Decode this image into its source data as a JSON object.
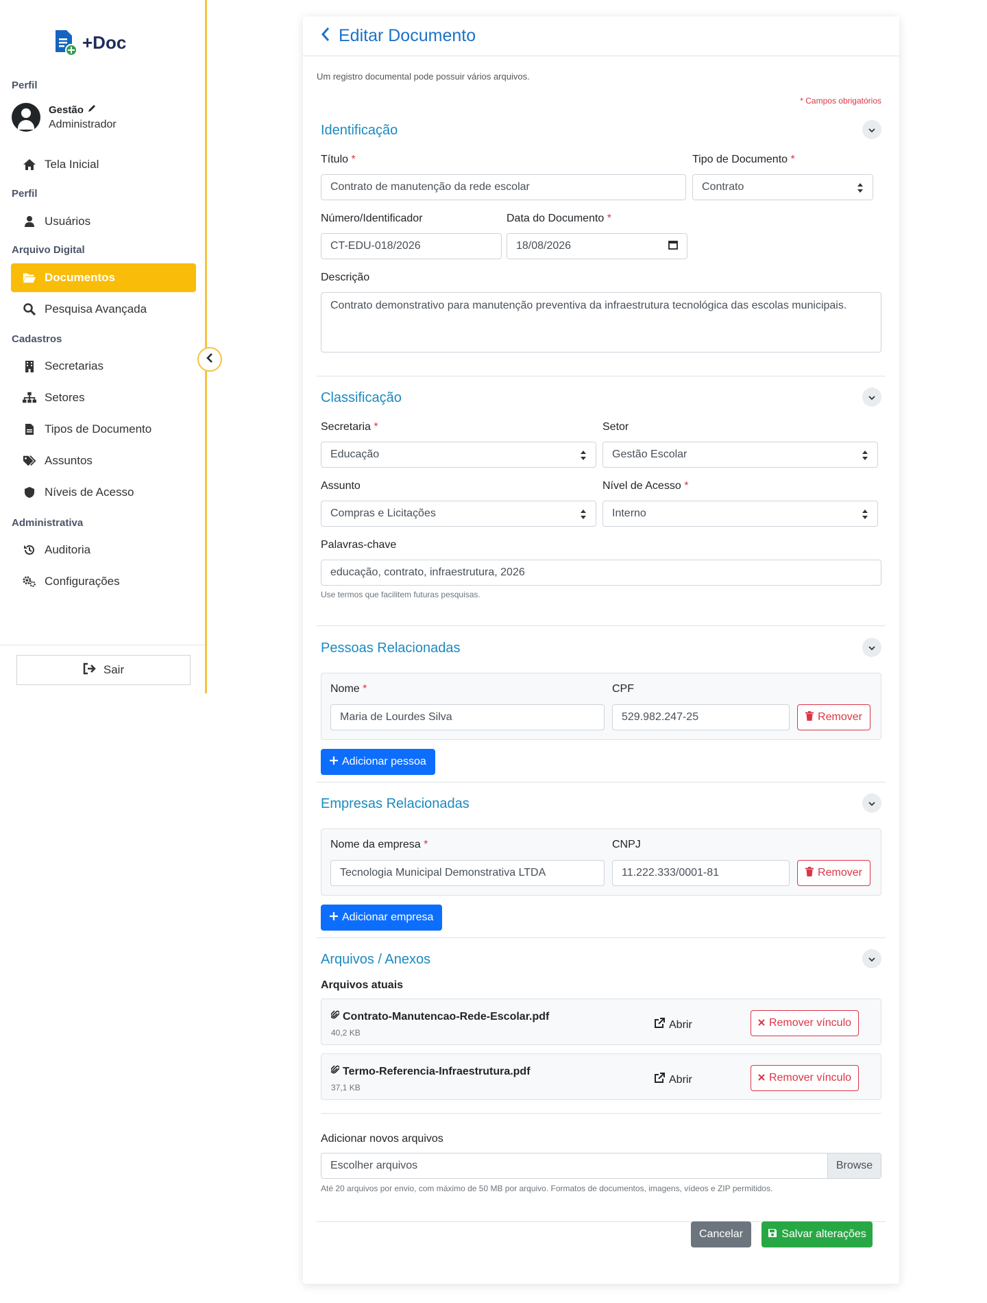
{
  "app": {
    "logo_text": "+Doc"
  },
  "sidebar": {
    "profile_label": "Perfil",
    "profile": {
      "name": "Gestão",
      "role": "Administrador"
    },
    "items": [
      {
        "label": "Tela Inicial",
        "icon": "home-icon"
      },
      {
        "section": "Perfil"
      },
      {
        "label": "Usuários",
        "icon": "user-icon"
      },
      {
        "section": "Arquivo Digital"
      },
      {
        "label": "Documentos",
        "icon": "folder-open-icon",
        "active": true
      },
      {
        "label": "Pesquisa Avançada",
        "icon": "search-icon"
      },
      {
        "section": "Cadastros"
      },
      {
        "label": "Secretarias",
        "icon": "building-icon"
      },
      {
        "label": "Setores",
        "icon": "sitemap-icon"
      },
      {
        "label": "Tipos de Documento",
        "icon": "file-icon"
      },
      {
        "label": "Assuntos",
        "icon": "tags-icon"
      },
      {
        "label": "Níveis de Acesso",
        "icon": "shield-icon"
      },
      {
        "section": "Administrativa"
      },
      {
        "label": "Auditoria",
        "icon": "history-icon"
      },
      {
        "label": "Configurações",
        "icon": "cogs-icon"
      }
    ],
    "logout_label": "Sair"
  },
  "form": {
    "title": "Editar Documento",
    "subtitle": "Um registro documental pode possuir vários arquivos.",
    "required_note": "* Campos obrigatórios",
    "identificacao": {
      "title": "Identificação",
      "titulo_label": "Título",
      "titulo_value": "Contrato de manutenção da rede escolar",
      "tipo_label": "Tipo de Documento",
      "tipo_value": "Contrato",
      "numero_label": "Número/Identificador",
      "numero_value": "CT-EDU-018/2026",
      "data_label": "Data do Documento",
      "data_value": "18/08/2026",
      "descricao_label": "Descrição",
      "descricao_value": "Contrato demonstrativo para manutenção preventiva da infraestrutura tecnológica das escolas municipais."
    },
    "classificacao": {
      "title": "Classificação",
      "secretaria_label": "Secretaria",
      "secretaria_value": "Educação",
      "setor_label": "Setor",
      "setor_value": "Gestão Escolar",
      "assunto_label": "Assunto",
      "assunto_value": "Compras e Licitações",
      "nivel_label": "Nível de Acesso",
      "nivel_value": "Interno",
      "palavras_label": "Palavras-chave",
      "palavras_value": "educação, contrato, infraestrutura, 2026",
      "palavras_help": "Use termos que facilitem futuras pesquisas."
    },
    "pessoas": {
      "title": "Pessoas Relacionadas",
      "nome_label": "Nome",
      "cpf_label": "CPF",
      "nome_value": "Maria de Lourdes Silva",
      "cpf_value": "529.982.247-25",
      "remove_label": "Remover",
      "add_label": "Adicionar pessoa"
    },
    "empresas": {
      "title": "Empresas Relacionadas",
      "nome_label": "Nome da empresa",
      "cnpj_label": "CNPJ",
      "nome_value": "Tecnologia Municipal Demonstrativa LTDA",
      "cnpj_value": "11.222.333/0001-81",
      "remove_label": "Remover",
      "add_label": "Adicionar empresa"
    },
    "arquivos": {
      "title": "Arquivos / Anexos",
      "atuais_label": "Arquivos atuais",
      "files": [
        {
          "name": "Contrato-Manutencao-Rede-Escolar.pdf",
          "size": "40,2 KB"
        },
        {
          "name": "Termo-Referencia-Infraestrutura.pdf",
          "size": "37,1 KB"
        }
      ],
      "open_label": "Abrir",
      "unlink_label": "Remover vínculo",
      "novos_label": "Adicionar novos arquivos",
      "file_placeholder": "Escolher arquivos",
      "browse_label": "Browse",
      "help": "Até 20 arquivos por envio, com máximo de 50 MB por arquivo. Formatos de documentos, imagens, vídeos e ZIP permitidos."
    },
    "cancel_label": "Cancelar",
    "save_label": "Salvar alterações"
  },
  "colors": {
    "accent": "#f9bc09",
    "primary": "#0d6efd",
    "section_title": "#1b8ac0",
    "danger": "#dc3545",
    "success": "#28a745"
  }
}
